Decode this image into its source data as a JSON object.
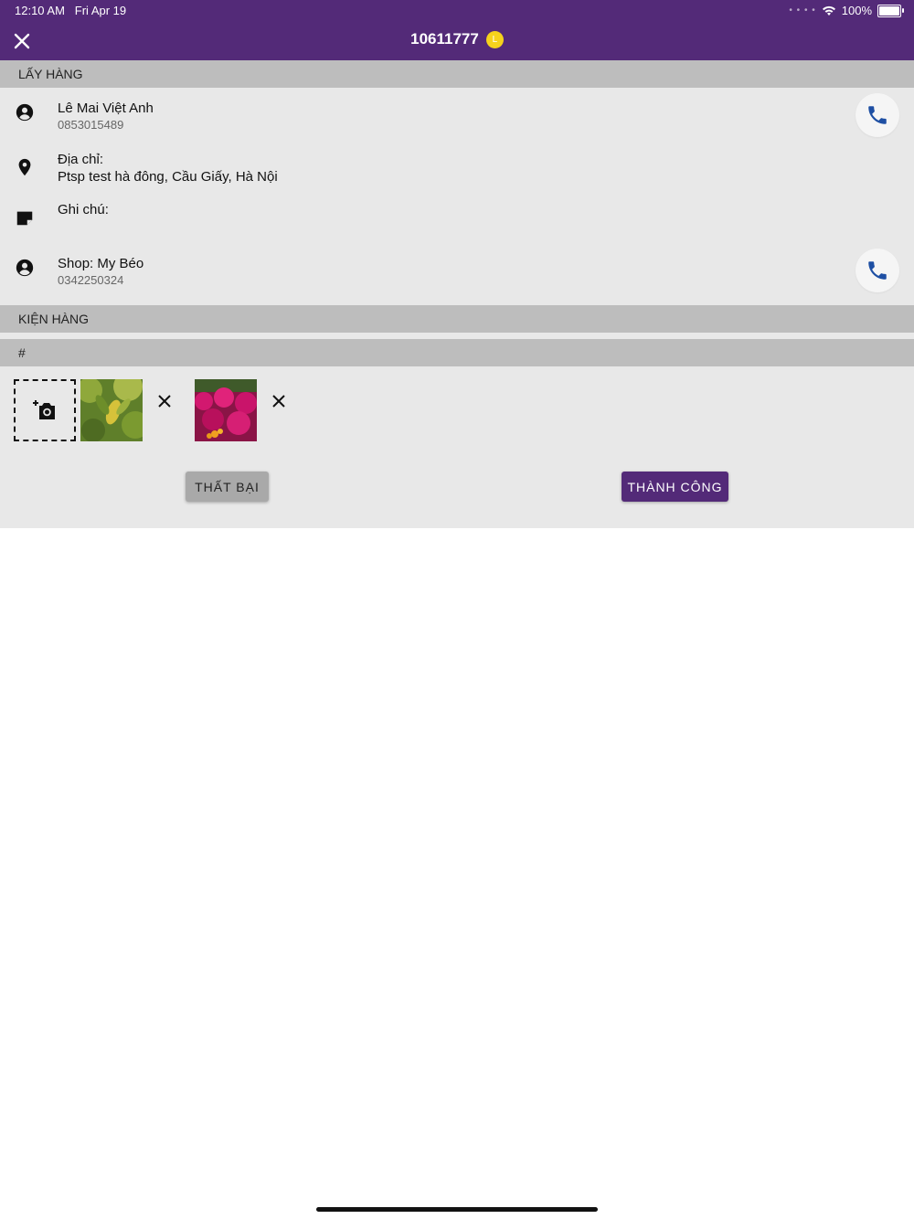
{
  "status_bar": {
    "time": "12:10 AM",
    "date": "Fri Apr 19",
    "battery": "100%"
  },
  "header": {
    "order_id": "10611777",
    "badge": "L"
  },
  "pickup": {
    "section_title": "LẤY HÀNG",
    "customer_name": "Lê Mai Việt Anh",
    "customer_phone": "0853015489",
    "address_label": "Địa chỉ:",
    "address_value": "Ptsp test hà đông, Cầu Giấy, Hà Nội",
    "note_label": "Ghi chú:",
    "shop_name": "Shop: My Béo",
    "shop_phone": "0342250324"
  },
  "package": {
    "section_title": "KIỆN HÀNG",
    "table_header": "#"
  },
  "photos": [
    {
      "name": "photo-green-leaves"
    },
    {
      "name": "photo-pink-flowers"
    }
  ],
  "actions": {
    "fail_label": "THẤT BẠI",
    "success_label": "THÀNH CÔNG"
  },
  "colors": {
    "primary": "#532a78",
    "section_header": "#bdbdbd",
    "panel": "#e8e8e8",
    "phone_icon": "#1e4fa3",
    "badge": "#f5d21c"
  },
  "icons": [
    "close-icon",
    "person-icon",
    "location-pin-icon",
    "note-icon",
    "phone-icon",
    "add-camera-icon",
    "remove-icon",
    "wifi-icon",
    "battery-icon"
  ]
}
